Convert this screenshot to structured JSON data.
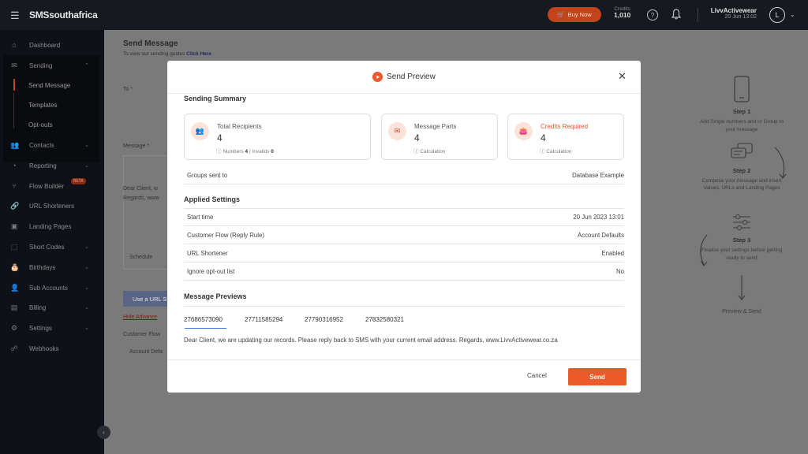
{
  "app": {
    "logo": "SMSsouthafrica"
  },
  "topbar": {
    "buy_now": "Buy Now",
    "credits_label": "Credits",
    "credits_value": "1,010",
    "user_name": "LivvActivewear",
    "user_date": "20 Jun 13:02",
    "avatar_initial": "L"
  },
  "sidebar": {
    "items": [
      {
        "label": "Dashboard",
        "icon": "home-icon"
      },
      {
        "label": "Sending",
        "icon": "mail-icon"
      },
      {
        "label": "Send Message"
      },
      {
        "label": "Templates"
      },
      {
        "label": "Opt-outs"
      },
      {
        "label": "Contacts",
        "icon": "contacts-icon"
      },
      {
        "label": "Reporting",
        "icon": "chart-icon"
      },
      {
        "label": "Flow Builder",
        "icon": "flow-icon",
        "badge": "BETA"
      },
      {
        "label": "URL Shorteners",
        "icon": "link-icon"
      },
      {
        "label": "Landing Pages",
        "icon": "page-icon"
      },
      {
        "label": "Short Codes",
        "icon": "shortcode-icon"
      },
      {
        "label": "Birthdays",
        "icon": "cake-icon"
      },
      {
        "label": "Sub Accounts",
        "icon": "subaccount-icon"
      },
      {
        "label": "Billing",
        "icon": "billing-icon"
      },
      {
        "label": "Settings",
        "icon": "gear-icon"
      },
      {
        "label": "Webhooks",
        "icon": "webhook-icon"
      }
    ]
  },
  "background": {
    "title": "Send Message",
    "subtitle": "To view our sending guides",
    "subtitle_link": "Click Here",
    "to_label": "To *",
    "message_label": "Message *",
    "schedule_label": "Schedule",
    "use_url_btn": "Use a URL S",
    "hide_advanced": "Hide Advance",
    "customer_flow_label": "Customer Flow",
    "account_defaults": "Account Defa",
    "msg_preview": "Dear Client, w",
    "msg_preview2": "Regards, www"
  },
  "steps": [
    {
      "title": "Step 1",
      "desc": "Add Single numbers and or Group to your message"
    },
    {
      "title": "Step 2",
      "desc": "Compose your message and insert Values, URLs and Landing Pages"
    },
    {
      "title": "Step 3",
      "desc": "Finalise your settings before getting ready to send"
    },
    {
      "title": "Preview & Send"
    }
  ],
  "modal": {
    "title": "Send Preview",
    "sending_summary": "Sending Summary",
    "cards": [
      {
        "label": "Total Recipients",
        "value": "4",
        "foot_a": "Numbers",
        "foot_a_val": "4",
        "foot_b": "Invalids",
        "foot_b_val": "0",
        "icon": "users-icon"
      },
      {
        "label": "Message Parts",
        "value": "4",
        "foot": "Calculation",
        "icon": "message-icon"
      },
      {
        "label": "Credits Required",
        "value": "4",
        "foot": "Calculation",
        "icon": "wallet-icon",
        "accent": "#e0532b"
      }
    ],
    "groups_label": "Groups sent to",
    "groups_value": "Database Example",
    "applied_settings": "Applied Settings",
    "settings": [
      {
        "label": "Start time",
        "value": "20 Jun 2023 13:01"
      },
      {
        "label": "Customer Flow (Reply Rule)",
        "value": "Account Defaults"
      },
      {
        "label": "URL Shortener",
        "value": "Enabled"
      },
      {
        "label": "Ignore opt-out list",
        "value": "No"
      }
    ],
    "message_previews": "Message Previews",
    "numbers": [
      "27686573090",
      "27711585294",
      "27790316952",
      "27832580321"
    ],
    "message": "Dear Client, we are updating our records. Please reply back to SMS with your current email address. Regards, www.LivvActivewear.co.za",
    "cancel": "Cancel",
    "send": "Send"
  },
  "colors": {
    "accent": "#ea5a2a",
    "sidebar": "#0e1117",
    "topbar": "#16191f"
  }
}
